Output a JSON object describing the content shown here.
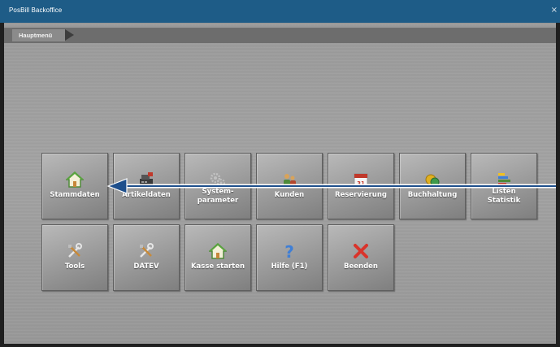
{
  "window": {
    "title": "PosBill Backoffice",
    "close_glyph": "×"
  },
  "breadcrumb": {
    "items": [
      "Hauptmenü"
    ]
  },
  "tiles": [
    {
      "label": "Stammdaten",
      "icon": "house-icon"
    },
    {
      "label": "Artikeldaten",
      "icon": "register-icon"
    },
    {
      "label": "System-\nparameter",
      "icon": "gears-icon"
    },
    {
      "label": "Kunden",
      "icon": "customers-icon"
    },
    {
      "label": "Reservierung",
      "icon": "calendar-icon",
      "icon_text": "31"
    },
    {
      "label": "Buchhaltung",
      "icon": "coins-icon"
    },
    {
      "label": "Listen\nStatistik",
      "icon": "bar-chart-icon"
    },
    {
      "label": "Tools",
      "icon": "tools-icon"
    },
    {
      "label": "DATEV",
      "icon": "tools-icon"
    },
    {
      "label": "Kasse starten",
      "icon": "house-icon"
    },
    {
      "label": "Hilfe (F1)",
      "icon": "help-icon",
      "icon_text": "?"
    },
    {
      "label": "Beenden",
      "icon": "close-icon",
      "icon_text": "✖"
    }
  ],
  "colors": {
    "titlebar": "#1e5c87",
    "annotation_arrow": "#1e4f8c",
    "close_red": "#d9342b",
    "help_blue": "#3f7fd6"
  }
}
